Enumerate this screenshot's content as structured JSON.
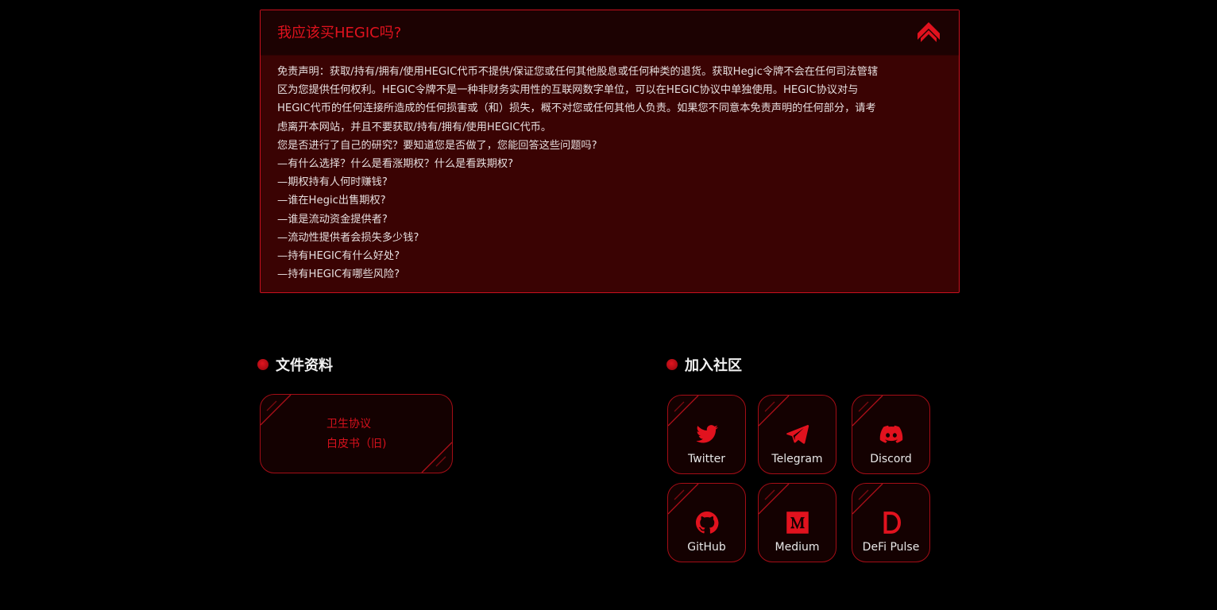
{
  "faq": {
    "title": "我应该买HEGIC吗?",
    "lines": [
      "免责声明：获取/持有/拥有/使用HEGIC代币不提供/保证您或任何其他股息或任何种类的退货。获取Hegic令牌不会在任何司法管辖",
      "区为您提供任何权利。HEGIC令牌不是一种非财务实用性的互联网数字单位，可以在HEGIC协议中单独使用。HEGIC协议对与",
      "HEGIC代币的任何连接所造成的任何损害或（和）损失，概不对您或任何其他人负责。如果您不同意本免责声明的任何部分，请考",
      "虑离开本网站，并且不要获取/持有/拥有/使用HEGIC代币。",
      "您是否进行了自己的研究？要知道您是否做了，您能回答这些问题吗?",
      "—有什么选择？什么是看涨期权？什么是看跌期权?",
      "—期权持有人何时赚钱?",
      "—谁在Hegic出售期权?",
      "—谁是流动资金提供者?",
      "—流动性提供者会损失多少钱?",
      "—持有HEGIC有什么好处?",
      "—持有HEGIC有哪些风险?"
    ]
  },
  "docs": {
    "heading": "文件资料",
    "links": [
      "卫生协议",
      "白皮书（旧)"
    ]
  },
  "community": {
    "heading": "加入社区",
    "items": [
      {
        "label": "Twitter",
        "icon": "twitter-icon"
      },
      {
        "label": "Telegram",
        "icon": "telegram-icon"
      },
      {
        "label": "Discord",
        "icon": "discord-icon"
      },
      {
        "label": "GitHub",
        "icon": "github-icon"
      },
      {
        "label": "Medium",
        "icon": "medium-icon"
      },
      {
        "label": "DeFi Pulse",
        "icon": "defi-pulse-icon"
      }
    ]
  },
  "colors": {
    "accent": "#e1121e",
    "panel_bg": "#3a0303",
    "panel_header_bg": "#1c0202",
    "page_bg": "#000000"
  }
}
